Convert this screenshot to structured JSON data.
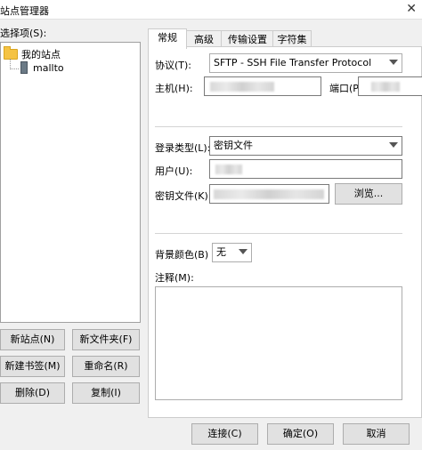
{
  "window": {
    "title": "站点管理器",
    "close_icon": "close-icon"
  },
  "left": {
    "select_label": "选择项(S):",
    "tree": {
      "root": "我的站点",
      "child": "mallto"
    },
    "buttons": {
      "new_site": "新站点(N)",
      "new_folder": "新文件夹(F)",
      "new_bookmark": "新建书签(M)",
      "rename": "重命名(R)",
      "delete": "删除(D)",
      "copy": "复制(I)"
    }
  },
  "tabs": [
    "常规",
    "高级",
    "传输设置",
    "字符集"
  ],
  "general": {
    "protocol_label": "协议(T):",
    "protocol_value": "SFTP - SSH File Transfer Protocol",
    "host_label": "主机(H):",
    "port_label": "端口(P",
    "logon_type_label": "登录类型(L):",
    "logon_type_value": "密钥文件",
    "user_label": "用户(U):",
    "keyfile_label": "密钥文件(K):",
    "browse_button": "浏览...",
    "bg_color_label": "背景颜色(B)",
    "bg_color_value": "无",
    "notes_label": "注释(M):"
  },
  "footer": {
    "connect": "连接(C)",
    "ok": "确定(O)",
    "cancel": "取消"
  }
}
